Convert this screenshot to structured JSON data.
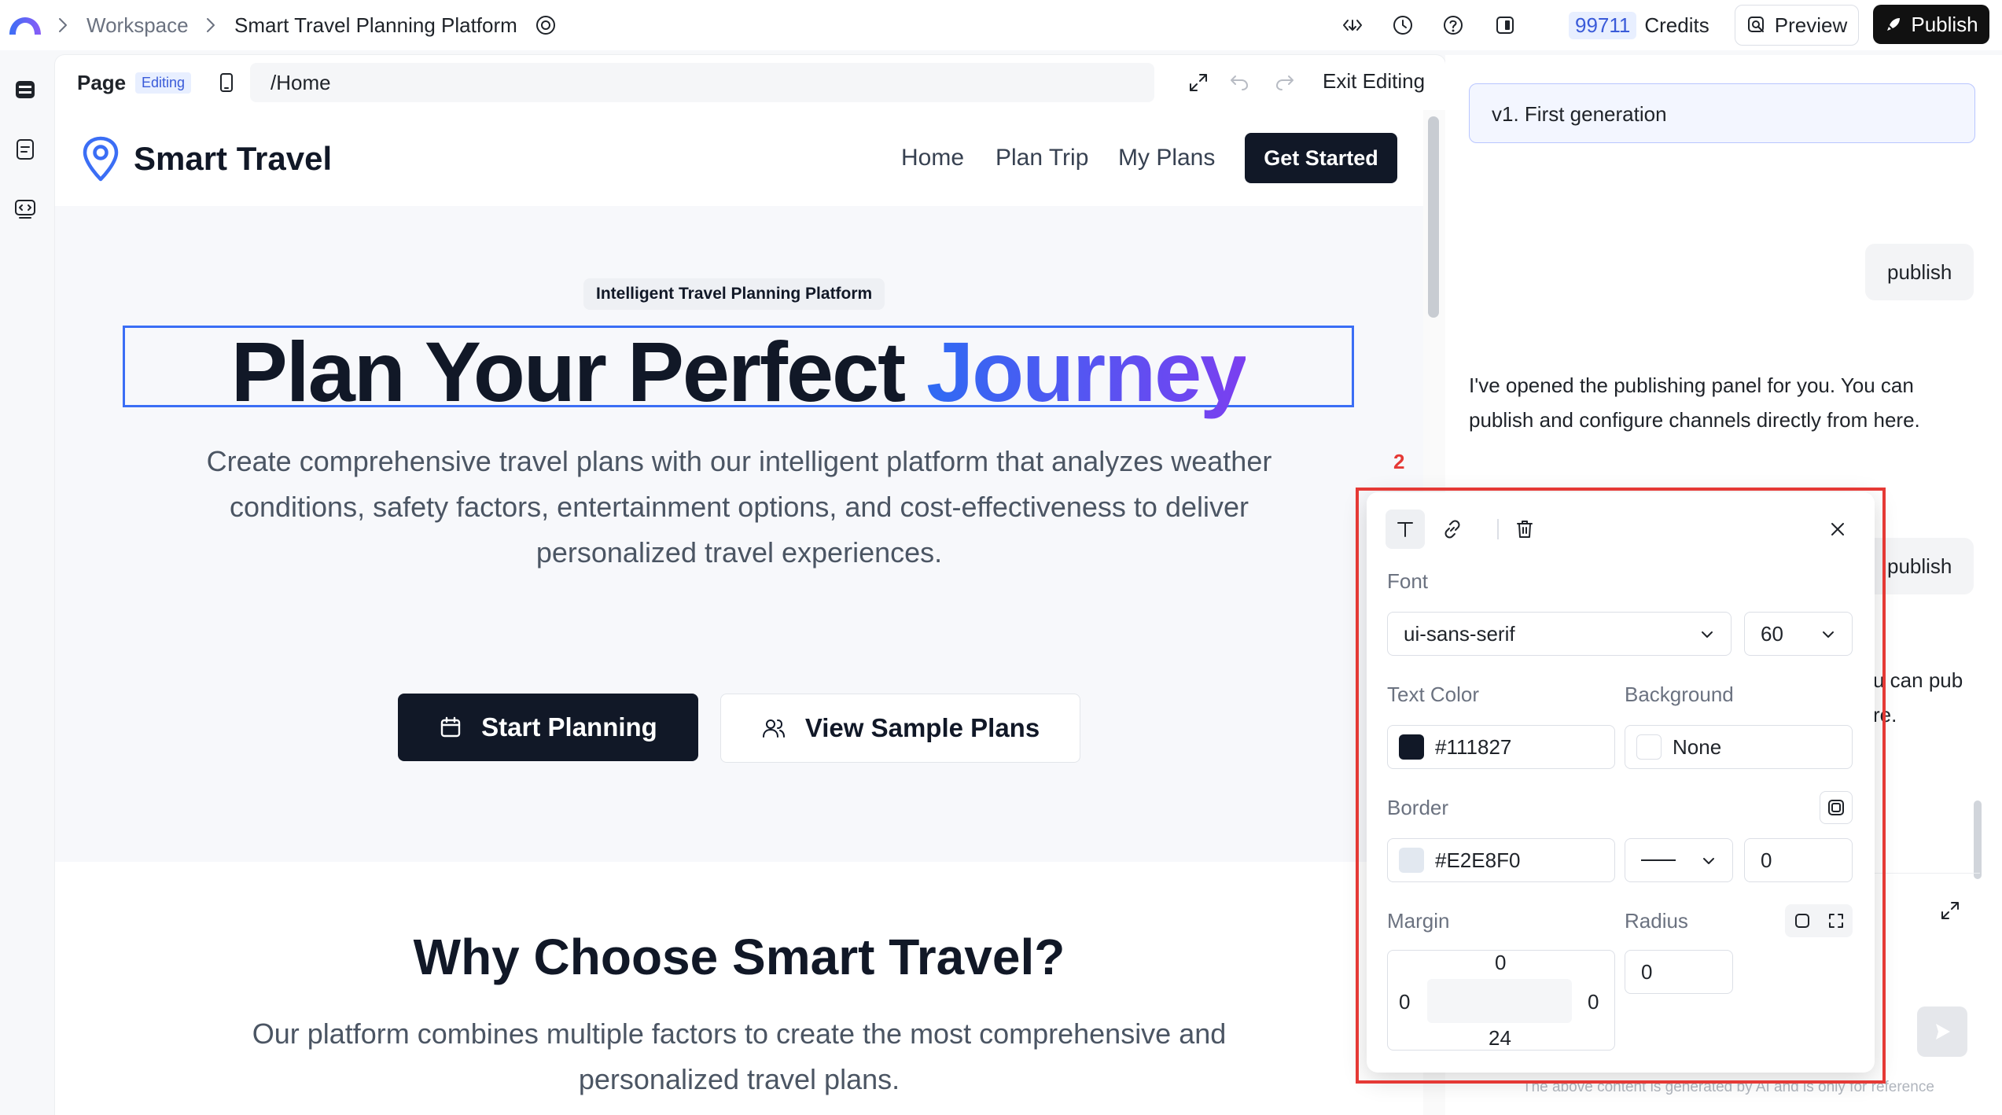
{
  "topbar": {
    "breadcrumb": [
      "Workspace",
      "Smart Travel Planning Platform"
    ],
    "credits_value": "99711",
    "credits_label": "Credits",
    "preview_label": "Preview",
    "publish_label": "Publish"
  },
  "editor": {
    "page_label": "Page",
    "editing_badge": "Editing",
    "path": "/Home",
    "exit_label": "Exit Editing"
  },
  "site": {
    "brand": "Smart Travel",
    "nav": [
      "Home",
      "Plan Trip",
      "My Plans"
    ],
    "cta": "Get Started",
    "hero_tag": "Intelligent Travel Planning Platform",
    "hero_title_main": "Plan Your Perfect ",
    "hero_title_accent": "Journey",
    "hero_subtitle": "Create comprehensive travel plans with our intelligent platform that analyzes weather conditions, safety factors, entertainment options, and cost-effectiveness to deliver personalized travel experiences.",
    "btn_start": "Start Planning",
    "btn_sample": "View Sample Plans",
    "why_title": "Why Choose Smart Travel?",
    "why_subtitle": "Our platform combines multiple factors to create the most comprehensive and personalized travel plans."
  },
  "step_marker": "2",
  "chat": {
    "generation": "v1. First generation",
    "user_msg_1": "publish",
    "ai_msg": "I've opened the publishing panel for you. You can publish and configure channels directly from here.",
    "user_msg_2": "publish",
    "ai_clip_1": "u can pub",
    "ai_clip_2": "re.",
    "footer_note": "The above content is generated by AI and is only for reference"
  },
  "style_panel": {
    "font_label": "Font",
    "font_family": "ui-sans-serif",
    "font_size": "60",
    "text_color_label": "Text Color",
    "text_color": "#111827",
    "background_label": "Background",
    "background_value": "None",
    "border_label": "Border",
    "border_color": "#E2E8F0",
    "border_width": "0",
    "margin_label": "Margin",
    "margin_top": "0",
    "margin_right": "0",
    "margin_bottom": "24",
    "margin_left": "0",
    "radius_label": "Radius",
    "radius_value": "0"
  },
  "colors": {
    "accent_blue": "#3b6ef5",
    "selection_outline": "#e53935",
    "text_color_swatch": "#111827",
    "border_color_swatch": "#E2E8F0"
  }
}
